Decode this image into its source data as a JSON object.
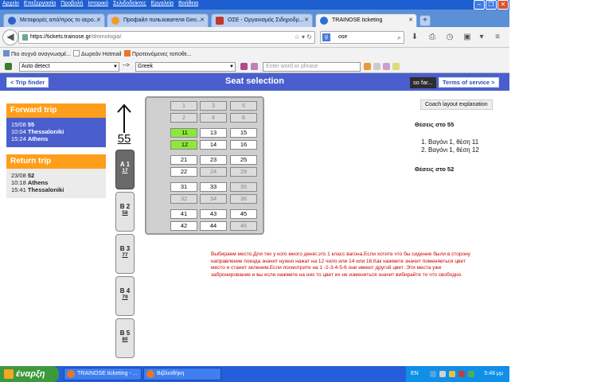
{
  "browser": {
    "menu": [
      "Αρχείο",
      "Επεξεργασία",
      "Προβολή",
      "Ιστορικό",
      "Σελιδοδείκτες",
      "Εργαλεία",
      "Βοήθεια"
    ],
    "tabs": [
      {
        "label": "Μεταφορές από/προς το αερο...",
        "active": false
      },
      {
        "label": "Профайл пользователя Geo...",
        "active": false
      },
      {
        "label": "ΟΣΕ - Οργανισμός Σιδηροδρ...",
        "active": false
      },
      {
        "label": "TRAINOSE ticketing",
        "active": true
      }
    ],
    "url_host": "https://tickets.trainose.gr",
    "url_path": "/dromologia/",
    "search_value": "ose",
    "bookmarks": [
      "Πιο συχνά αναγνωσμέ...",
      "Δωρεάν Hotmail",
      "Προτεινόμενες τοποθε..."
    ],
    "translate": {
      "from": "Auto detect",
      "arrow": "-->",
      "to": "Greek",
      "placeholder": "Enter word or phrase"
    }
  },
  "page": {
    "title": "Seat selection",
    "trip_finder": "< Trip finder",
    "so_far": "so far...",
    "terms": "Terms of service >",
    "forward": {
      "heading": "Forward trip",
      "date": "15/08",
      "train": "55",
      "dep_time": "10:04",
      "dep_station": "Thessaloniki",
      "arr_time": "15:24",
      "arr_station": "Athens"
    },
    "return": {
      "heading": "Return trip",
      "date": "23/08",
      "train": "52",
      "dep_time": "10:18",
      "dep_station": "Athens",
      "arr_time": "15:41",
      "arr_station": "Thessaloniki"
    },
    "train_number": "55",
    "coaches": [
      {
        "label": "A 1",
        "num": "17",
        "active": true
      },
      {
        "label": "B 2",
        "num": "58",
        "active": false
      },
      {
        "label": "B 3",
        "num": "77",
        "active": false
      },
      {
        "label": "B 4",
        "num": "79",
        "active": false
      },
      {
        "label": "B 5",
        "num": "80",
        "active": false
      }
    ],
    "seat_rows": [
      [
        {
          "n": "1",
          "s": "occ"
        },
        {
          "n": "3",
          "s": "occ"
        },
        {
          "n": "5",
          "s": "occ"
        }
      ],
      [
        {
          "n": "2",
          "s": "occ"
        },
        {
          "n": "4",
          "s": "occ"
        },
        {
          "n": "6",
          "s": "occ"
        }
      ],
      [
        {
          "n": "11",
          "s": "sel"
        },
        {
          "n": "13",
          "s": "free"
        },
        {
          "n": "15",
          "s": "free"
        }
      ],
      [
        {
          "n": "12",
          "s": "sel"
        },
        {
          "n": "14",
          "s": "free"
        },
        {
          "n": "16",
          "s": "free"
        }
      ],
      [
        {
          "n": "21",
          "s": "free"
        },
        {
          "n": "23",
          "s": "free"
        },
        {
          "n": "25",
          "s": "free"
        }
      ],
      [
        {
          "n": "22",
          "s": "free"
        },
        {
          "n": "24",
          "s": "occ"
        },
        {
          "n": "26",
          "s": "occ"
        }
      ],
      [
        {
          "n": "31",
          "s": "free"
        },
        {
          "n": "33",
          "s": "free"
        },
        {
          "n": "35",
          "s": "occ"
        }
      ],
      [
        {
          "n": "32",
          "s": "occ"
        },
        {
          "n": "34",
          "s": "occ"
        },
        {
          "n": "36",
          "s": "occ"
        }
      ],
      [
        {
          "n": "41",
          "s": "free"
        },
        {
          "n": "43",
          "s": "free"
        },
        {
          "n": "45",
          "s": "free"
        }
      ],
      [
        {
          "n": "42",
          "s": "free"
        },
        {
          "n": "44",
          "s": "free"
        },
        {
          "n": "46",
          "s": "occ"
        }
      ]
    ],
    "coach_layout_button": "Coach layout explanation",
    "seats_55_heading": "Θέσεις στο 55",
    "selected_seats": [
      "Βαγόνι 1, θέση 11",
      "Βαγόνι 1, θέση 12"
    ],
    "seats_52_heading": "Θέσεις στο 52",
    "note": "Выбираем место.Для тех у кого много денег.это 1 класс вагона.Если хотите что бы сидение были в сторону направление поезда значит нужно нажат на 12 чило или 14 или 16.Как нажмете значит поменяеться цвет место и станет зеленим.Если посмотрите на 1 -2-3-4-5-6 они имеют другой цвет .Эти места уже забронирование и вы если нажмете на них то цвет их не измениться значит вибирайте то что свободно."
  },
  "taskbar": {
    "start": "έναρξη",
    "buttons": [
      "TRAINOSE ticketing - ...",
      "Βιβλιοθήκη"
    ],
    "lang": "EN",
    "clock": "5:48 μμ"
  },
  "colors": {
    "header_blue": "#4a5fcd",
    "trip_orange": "#ff9e1a",
    "seat_selected": "#8ee83c"
  }
}
